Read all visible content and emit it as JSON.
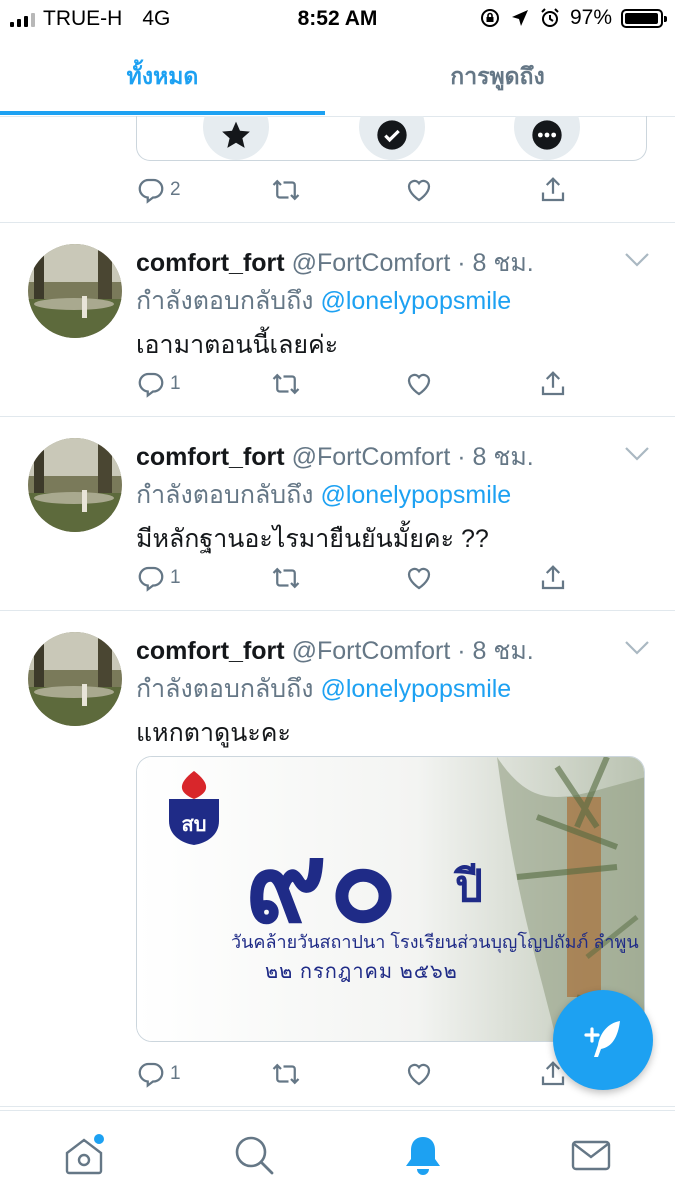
{
  "status_bar": {
    "carrier": "TRUE-H",
    "network": "4G",
    "time": "8:52 AM",
    "battery": "97%",
    "battery_level": 0.97
  },
  "tabs": [
    {
      "label": "ทั้งหมด",
      "active": true
    },
    {
      "label": "การพูดถึง",
      "active": false
    }
  ],
  "top_card": {
    "buttons": [
      "star-icon",
      "check-icon",
      "more-icon"
    ],
    "reply_count": "2"
  },
  "tweets": [
    {
      "name": "comfort_fort",
      "handle": "@FortComfort · 8 ชม.",
      "reply_prefix": "กำลังตอบกลับถึง",
      "mention": "@lonelypopsmile",
      "text": "เอามาตอนนี้เลยค่ะ",
      "reply_count": "1"
    },
    {
      "name": "comfort_fort",
      "handle": "@FortComfort · 8 ชม.",
      "reply_prefix": "กำลังตอบกลับถึง",
      "mention": "@lonelypopsmile",
      "text": "มีหลักฐานอะไรมายืนยันมั้ยคะ ??",
      "reply_count": "1"
    },
    {
      "name": "comfort_fort",
      "handle": "@FortComfort · 8 ชม.",
      "reply_prefix": "กำลังตอบกลับถึง",
      "mention": "@lonelypopsmile",
      "text": "แหกตาดูนะคะ",
      "reply_count": "1",
      "media": {
        "big_numeral": "๙๐",
        "big_suffix": "ปี",
        "line1": "วันคล้ายวันสถาปนา โรงเรียนส่วนบุญโญปถัมภ์ ลำพูน",
        "line2": "๒๒ กรกฎาคม ๒๕๖๒",
        "logo_text": "สบ"
      }
    }
  ],
  "bottom_nav": [
    "home-icon",
    "search-icon",
    "notifications-icon",
    "messages-icon"
  ],
  "colors": {
    "accent": "#1da1f2",
    "text": "#14171a",
    "muted": "#657786",
    "divider": "#e1e8ed",
    "media_blue": "#1f2b87"
  }
}
